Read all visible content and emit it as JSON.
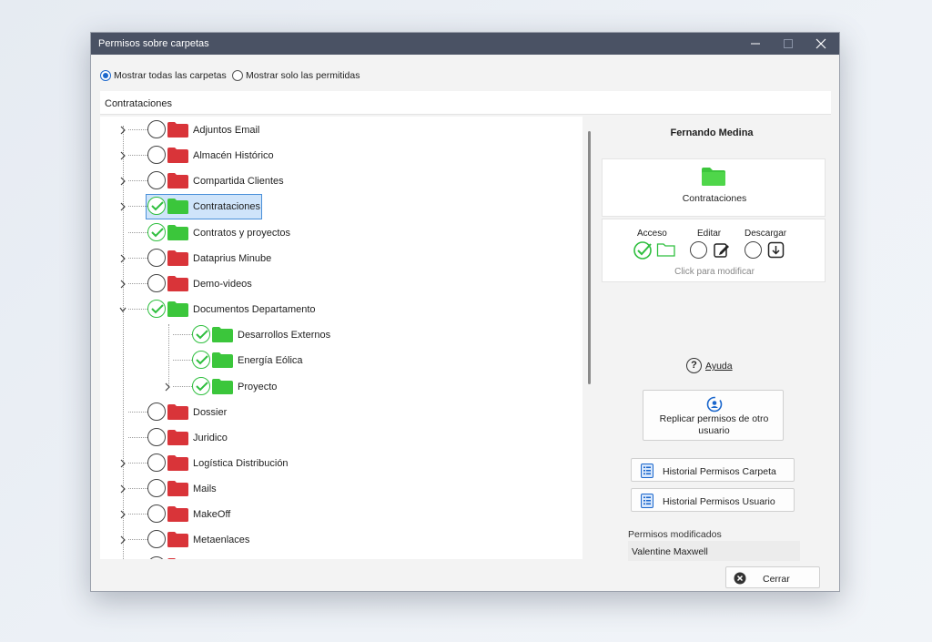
{
  "window": {
    "title": "Permisos sobre carpetas"
  },
  "filters": {
    "show_all_label": "Mostrar todas las carpetas",
    "show_permitted_label": "Mostrar solo las permitidas",
    "selected": "show_all"
  },
  "breadcrumb": "Contrataciones",
  "tree": [
    {
      "label": "Adjuntos Email",
      "checked": false,
      "level": 0,
      "expander": "collapsed"
    },
    {
      "label": "Almacén Histórico",
      "checked": false,
      "level": 0,
      "expander": "collapsed"
    },
    {
      "label": "Compartida Clientes",
      "checked": false,
      "level": 0,
      "expander": "collapsed"
    },
    {
      "label": "Contrataciones",
      "checked": true,
      "level": 0,
      "expander": "collapsed",
      "selected": true
    },
    {
      "label": "Contratos y proyectos",
      "checked": true,
      "level": 0,
      "expander": "none"
    },
    {
      "label": "Dataprius Minube",
      "checked": false,
      "level": 0,
      "expander": "collapsed"
    },
    {
      "label": "Demo-videos",
      "checked": false,
      "level": 0,
      "expander": "collapsed"
    },
    {
      "label": "Documentos Departamento",
      "checked": true,
      "level": 0,
      "expander": "expanded"
    },
    {
      "label": "Desarrollos Externos",
      "checked": true,
      "level": 1,
      "expander": "none"
    },
    {
      "label": "Energía Eólica",
      "checked": true,
      "level": 1,
      "expander": "none"
    },
    {
      "label": "Proyecto",
      "checked": true,
      "level": 1,
      "expander": "collapsed"
    },
    {
      "label": "Dossier",
      "checked": false,
      "level": 0,
      "expander": "none"
    },
    {
      "label": "Juridico",
      "checked": false,
      "level": 0,
      "expander": "none"
    },
    {
      "label": "Logística Distribución",
      "checked": false,
      "level": 0,
      "expander": "collapsed"
    },
    {
      "label": "Mails",
      "checked": false,
      "level": 0,
      "expander": "collapsed"
    },
    {
      "label": "MakeOff",
      "checked": false,
      "level": 0,
      "expander": "collapsed"
    },
    {
      "label": "Metaenlaces",
      "checked": false,
      "level": 0,
      "expander": "collapsed"
    },
    {
      "label": "",
      "checked": false,
      "level": 0,
      "expander": "collapsed"
    }
  ],
  "panel": {
    "user_name": "Fernando Medina",
    "folder_name": "Contrataciones",
    "permissions": {
      "access_label": "Acceso",
      "edit_label": "Editar",
      "download_label": "Descargar",
      "access": true,
      "edit": false,
      "download": false,
      "hint": "Click para modificar"
    },
    "help_label": "Ayuda",
    "replicate_label": "Replicar permisos  de otro usuario",
    "history_folder_label": "Historial Permisos Carpeta",
    "history_user_label": "Historial Permisos Usuario",
    "modified_label": "Permisos modificados",
    "modified_value": "Valentine Maxwell"
  },
  "footer": {
    "close_label": "Cerrar"
  },
  "colors": {
    "titlebar": "#4a5264",
    "check_green": "#2fbf3f",
    "folder_denied": "#d9343a",
    "folder_allowed": "#3cc63c",
    "accent_blue": "#1a66cc",
    "selection": "#cfe4fa"
  }
}
